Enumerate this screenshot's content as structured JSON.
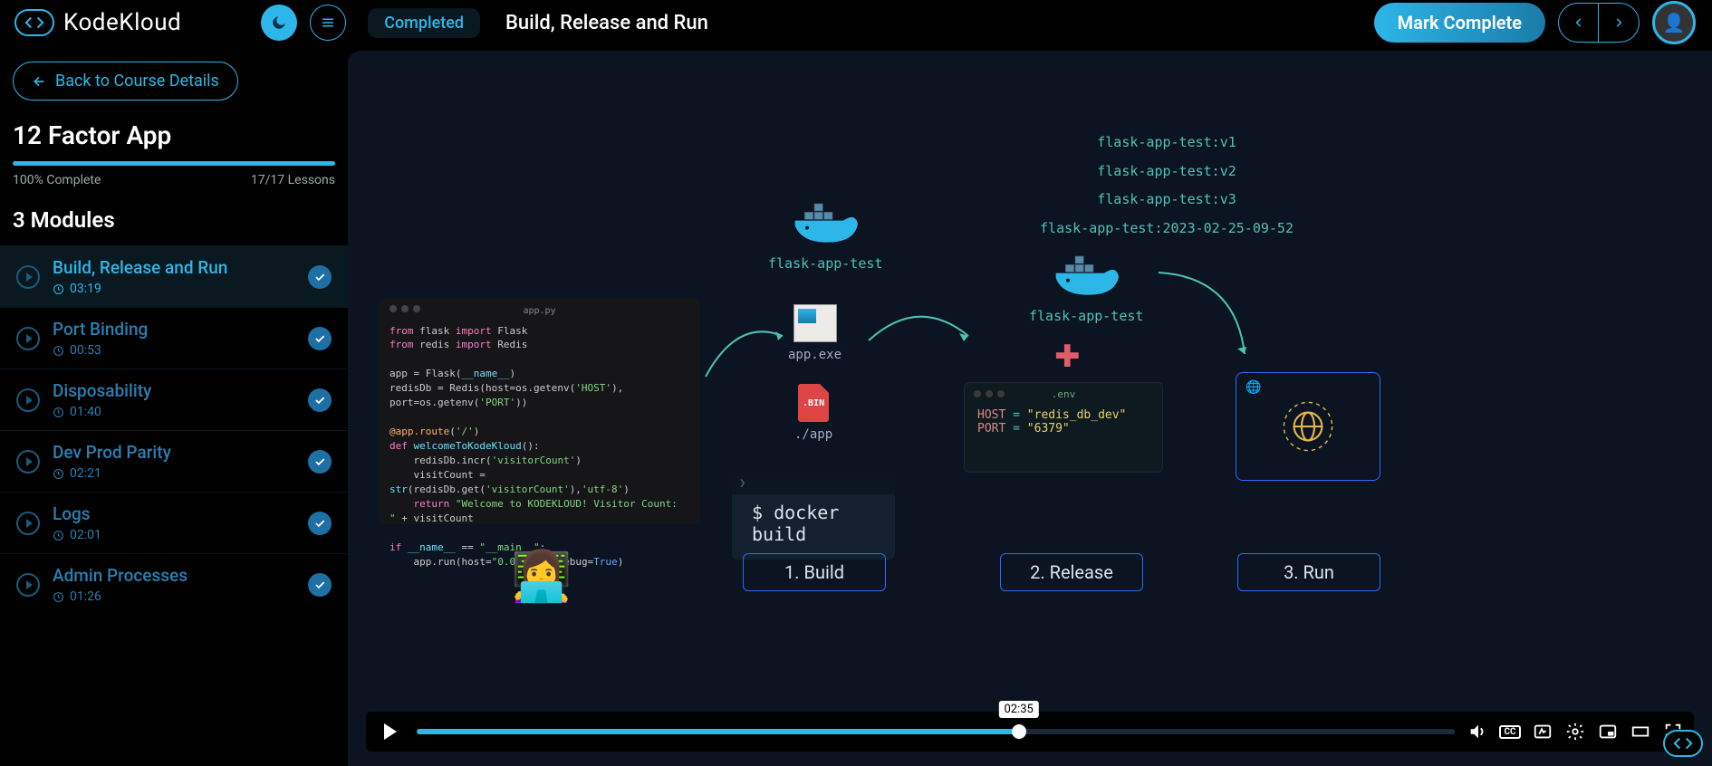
{
  "brand": "KodeKloud",
  "topbar": {
    "status": "Completed",
    "lesson_title": "Build, Release and Run",
    "mark_complete": "Mark Complete"
  },
  "sidebar": {
    "back_label": "Back to Course Details",
    "course_title": "12 Factor App",
    "progress_pct": 100,
    "progress_text": "100% Complete",
    "lessons_text": "17/17 Lessons",
    "modules_title": "3 Modules",
    "lessons": [
      {
        "name": "Build, Release and Run",
        "duration": "03:19",
        "active": true,
        "done": true
      },
      {
        "name": "Port Binding",
        "duration": "00:53",
        "active": false,
        "done": true
      },
      {
        "name": "Disposability",
        "duration": "01:40",
        "active": false,
        "done": true
      },
      {
        "name": "Dev Prod Parity",
        "duration": "02:21",
        "active": false,
        "done": true
      },
      {
        "name": "Logs",
        "duration": "02:01",
        "active": false,
        "done": true
      },
      {
        "name": "Admin Processes",
        "duration": "01:26",
        "active": false,
        "done": true
      }
    ]
  },
  "slide": {
    "code_filename": "app.py",
    "whale1_label": "flask-app-test",
    "whale2_label": "flask-app-test",
    "tags": [
      "flask-app-test:v1",
      "flask-app-test:v2",
      "flask-app-test:v3",
      "flask-app-test:2023-02-25-09-52"
    ],
    "exe_label": "app.exe",
    "bin_text": ".BIN",
    "bin_label": "./app",
    "term_cmd": "$ docker build",
    "env_filename": ".env",
    "env_lines": [
      {
        "key": "HOST",
        "value": "\"redis_db_dev\""
      },
      {
        "key": "PORT",
        "value": "\"6379\""
      }
    ],
    "stages": {
      "build": "1. Build",
      "release": "2. Release",
      "run": "3. Run"
    },
    "code_lines": [
      {
        "html": "<span class='kw-pink'>from</span> flask <span class='kw-pink'>import</span> Flask"
      },
      {
        "html": "<span class='kw-pink'>from</span> redis <span class='kw-pink'>import</span> Redis"
      },
      {
        "html": ""
      },
      {
        "html": "app = Flask(<span class='kw-cyan'>__name__</span>)"
      },
      {
        "html": "redisDb = Redis(host=os.getenv(<span class='kw-green'>'HOST'</span>), port=os.getenv(<span class='kw-green'>'PORT'</span>))"
      },
      {
        "html": ""
      },
      {
        "html": "<span class='kw-orange'>@app.route</span>(<span class='kw-green'>'/'</span>)"
      },
      {
        "html": "<span class='kw-pink'>def</span> <span class='kw-cyan'>welcomeToKodeKloud</span>():"
      },
      {
        "html": "&nbsp;&nbsp;&nbsp;&nbsp;redisDb.incr(<span class='kw-green'>'visitorCount'</span>)"
      },
      {
        "html": "&nbsp;&nbsp;&nbsp;&nbsp;visitCount = <span class='kw-cyan'>str</span>(redisDb.get(<span class='kw-green'>'visitorCount'</span>),<span class='kw-green'>'utf-8'</span>)"
      },
      {
        "html": "&nbsp;&nbsp;&nbsp;&nbsp;<span class='kw-pink'>return</span> <span class='kw-green'>\"Welcome to KODEKLOUD! Visitor Count: \"</span> + visitCount"
      },
      {
        "html": ""
      },
      {
        "html": "<span class='kw-pink'>if</span> <span class='kw-cyan'>__name__</span> == <span class='kw-green'>\"__main__\"</span>:"
      },
      {
        "html": "&nbsp;&nbsp;&nbsp;&nbsp;app.run(host=<span class='kw-green'>\"0.0.0.0\"</span>, debug=<span class='kw-blue'>True</span>)"
      }
    ]
  },
  "video": {
    "tooltip_time": "02:35",
    "progress_pct": 58
  }
}
